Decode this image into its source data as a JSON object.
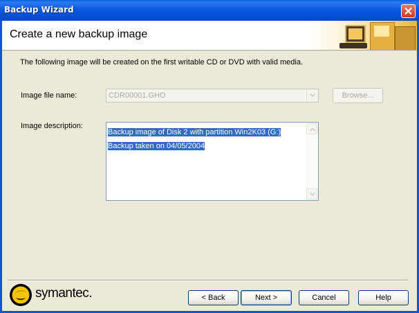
{
  "window": {
    "title": "Backup Wizard"
  },
  "header": {
    "title": "Create a new backup image"
  },
  "intro": "The following image will be created on the first writable CD or DVD with valid media.",
  "image_file": {
    "label": "Image file name:",
    "value": "CDR00001.GHO",
    "browse_label": "Browse..."
  },
  "image_description": {
    "label": "Image description:",
    "lines": [
      "Backup image of Disk 2 with partition Win2K03 (G:)",
      "Backup taken on 04/05/2004"
    ]
  },
  "brand": {
    "name": "symantec."
  },
  "buttons": {
    "back": "< Back",
    "next": "Next >",
    "cancel": "Cancel",
    "help": "Help"
  },
  "colors": {
    "titlebar": "#0a5fe0",
    "dialog_bg": "#ece9d8",
    "selection": "#316ac5",
    "logo_yellow": "#f5c400"
  }
}
